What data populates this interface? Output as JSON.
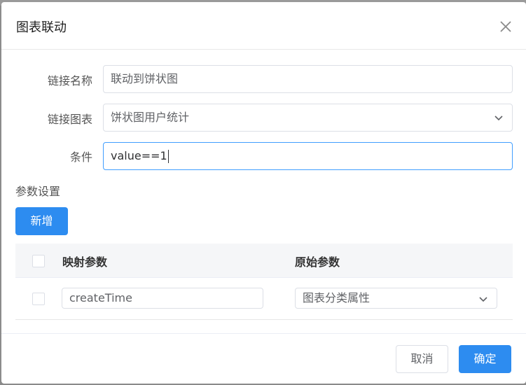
{
  "dialog": {
    "title": "图表联动",
    "close_icon": "close-icon"
  },
  "form": {
    "link_name_label": "链接名称",
    "link_name_value": "联动到饼状图",
    "link_chart_label": "链接图表",
    "link_chart_value": "饼状图用户统计",
    "condition_label": "条件",
    "condition_value": "value==1"
  },
  "params": {
    "section_label": "参数设置",
    "add_button": "新增",
    "columns": [
      "映射参数",
      "原始参数"
    ],
    "rows": [
      {
        "mapped_param": "createTime",
        "original_param": "图表分类属性"
      }
    ]
  },
  "footer": {
    "cancel_label": "取消",
    "confirm_label": "确定"
  },
  "colors": {
    "primary": "#2d8cf0",
    "focus_border": "#409eff"
  }
}
